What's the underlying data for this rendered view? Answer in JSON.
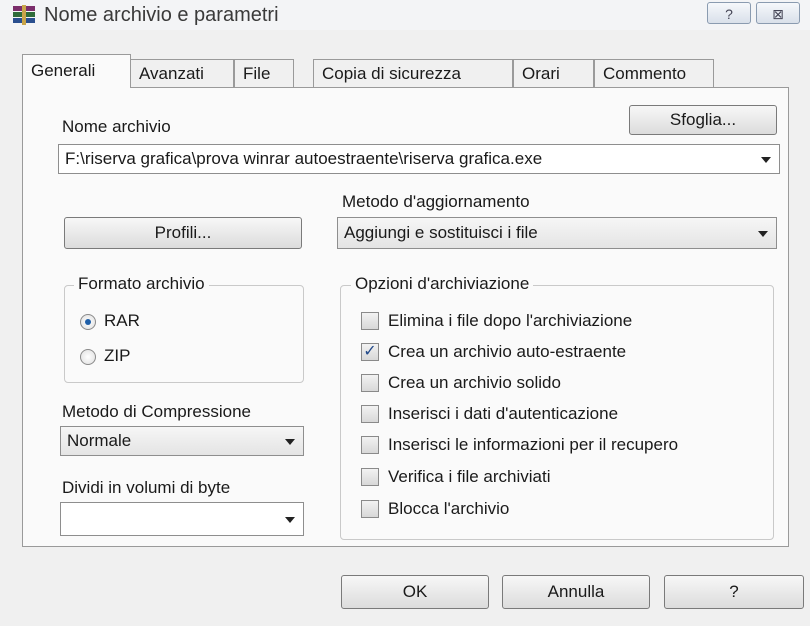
{
  "window": {
    "title": "Nome archivio e parametri",
    "help_glyph": "?",
    "close_glyph": "⊠"
  },
  "tabs": [
    {
      "label": "Generali",
      "active": true
    },
    {
      "label": "Avanzati",
      "active": false
    },
    {
      "label": "File",
      "active": false
    },
    {
      "label": "Copia di sicurezza",
      "active": false
    },
    {
      "label": "Orari",
      "active": false
    },
    {
      "label": "Commento",
      "active": false
    }
  ],
  "archive_name": {
    "label": "Nome archivio",
    "browse_label": "Sfoglia...",
    "value": "F:\\riserva grafica\\prova winrar autoestraente\\riserva grafica.exe"
  },
  "profiles_label": "Profili...",
  "update_method": {
    "label": "Metodo d'aggiornamento",
    "value": "Aggiungi e sostituisci i file"
  },
  "archive_format": {
    "label": "Formato archivio",
    "options": [
      {
        "label": "RAR",
        "selected": true
      },
      {
        "label": "ZIP",
        "selected": false
      }
    ]
  },
  "compression": {
    "label": "Metodo di Compressione",
    "value": "Normale"
  },
  "split_volumes": {
    "label": "Dividi in volumi di byte",
    "value": ""
  },
  "archiving_options": {
    "label": "Opzioni d'archiviazione",
    "items": [
      {
        "label": "Elimina i file dopo l'archiviazione",
        "checked": false
      },
      {
        "label": "Crea un archivio auto-estraente",
        "checked": true
      },
      {
        "label": "Crea un archivio solido",
        "checked": false
      },
      {
        "label": "Inserisci i dati d'autenticazione",
        "checked": false
      },
      {
        "label": "Inserisci le informazioni per il recupero",
        "checked": false
      },
      {
        "label": "Verifica i file archiviati",
        "checked": false
      },
      {
        "label": "Blocca l'archivio",
        "checked": false
      }
    ],
    "check_glyph": "✓"
  },
  "buttons": {
    "ok": "OK",
    "cancel": "Annulla",
    "help": "?"
  }
}
